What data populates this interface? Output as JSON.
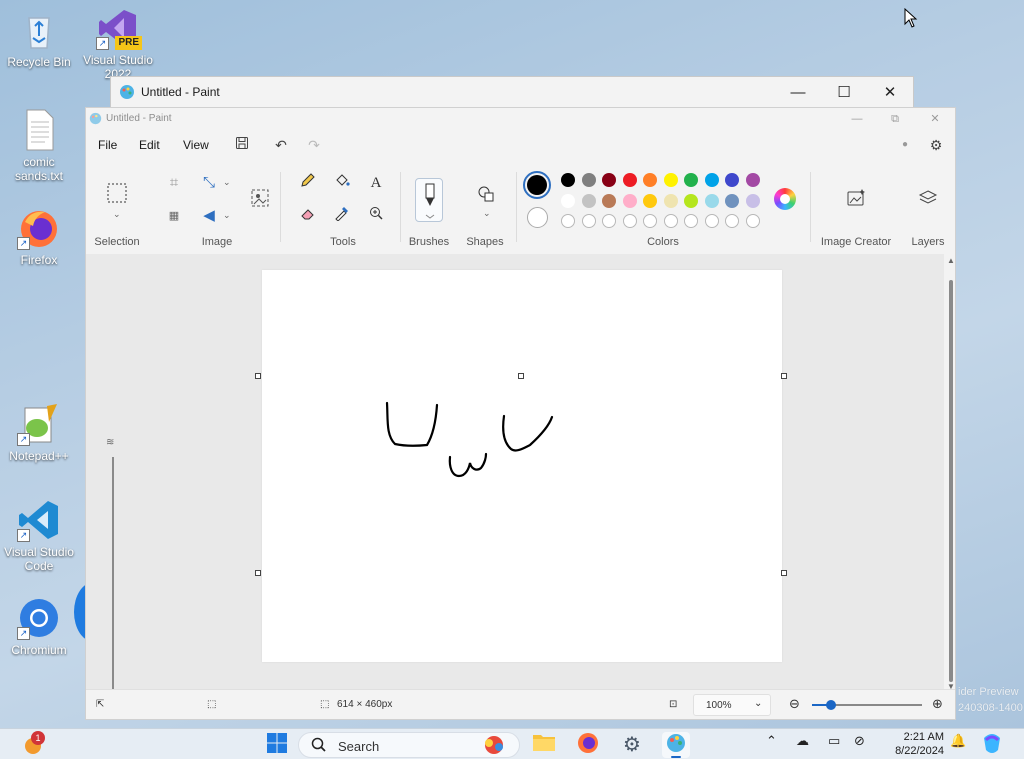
{
  "desktop": {
    "icons": [
      {
        "label": "Recycle Bin"
      },
      {
        "label": "Visual Studio 2022",
        "badge": "PRE"
      },
      {
        "label": "comic sands.txt"
      },
      {
        "label": "Firefox"
      },
      {
        "label": "Notepad++"
      },
      {
        "label": "Visual Studio Code"
      },
      {
        "label": "Chromium"
      }
    ],
    "watermark_line1": "ider Preview",
    "watermark_line2": "240308-1400"
  },
  "back_window": {
    "title": "Untitled - Paint",
    "controls": {
      "minimize": "—",
      "maximize": "☐",
      "close": "✕"
    }
  },
  "paint": {
    "title": "Untitled - Paint",
    "menu": {
      "file": "File",
      "edit": "Edit",
      "view": "View"
    },
    "groups": {
      "selection": "Selection",
      "image": "Image",
      "tools": "Tools",
      "brushes": "Brushes",
      "shapes": "Shapes",
      "colors": "Colors",
      "image_creator": "Image Creator",
      "layers": "Layers"
    },
    "colors": {
      "primary": "#000000",
      "secondary": "#ffffff",
      "row1": [
        "#000000",
        "#7f7f7f",
        "#880015",
        "#ed1c24",
        "#ff7f27",
        "#fff200",
        "#22b14c",
        "#00a2e8",
        "#3f48cc",
        "#a349a4"
      ],
      "row2": [
        "#ffffff",
        "#c3c3c3",
        "#b97a57",
        "#ffaec9",
        "#ffc90e",
        "#efe4b0",
        "#b5e61d",
        "#99d9ea",
        "#7092be",
        "#c8bfe7"
      ]
    },
    "status": {
      "canvas_size": "614 × 460px",
      "zoom": "100%"
    }
  },
  "taskbar": {
    "search_placeholder": "Search",
    "time": "2:21 AM",
    "date": "8/22/2024",
    "notification_count": "1"
  }
}
